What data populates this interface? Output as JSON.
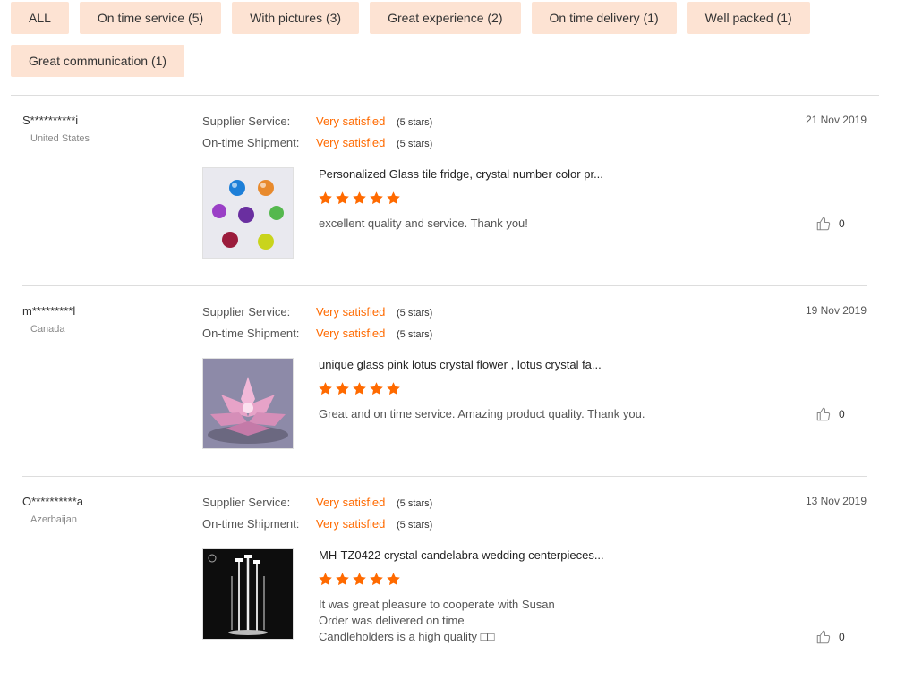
{
  "filters": [
    {
      "label": "ALL"
    },
    {
      "label": "On time service (5)"
    },
    {
      "label": "With pictures (3)"
    },
    {
      "label": "Great experience (2)"
    },
    {
      "label": "On time delivery (1)"
    },
    {
      "label": "Well packed (1)"
    },
    {
      "label": "Great communication (1)"
    }
  ],
  "colors": {
    "accent": "#ff6a00",
    "chip_bg": "#fde3d3",
    "separator": "#dddddd"
  },
  "reviews": [
    {
      "name": "S**********i",
      "country": "United States",
      "supplier_label": "Supplier Service:",
      "supplier_value": "Very satisfied",
      "supplier_stars": "(5 stars)",
      "shipment_label": "On-time Shipment:",
      "shipment_value": "Very satisfied",
      "shipment_stars": "(5 stars)",
      "date": "21 Nov 2019",
      "product_title": "Personalized Glass tile fridge, crystal number color pr...",
      "rating": 5,
      "comment_lines": [
        "excellent quality and service. Thank you!"
      ],
      "likes": "0"
    },
    {
      "name": "m*********l",
      "country": "Canada",
      "supplier_label": "Supplier Service:",
      "supplier_value": "Very satisfied",
      "supplier_stars": "(5 stars)",
      "shipment_label": "On-time Shipment:",
      "shipment_value": "Very satisfied",
      "shipment_stars": "(5 stars)",
      "date": "19 Nov 2019",
      "product_title": "unique glass pink lotus crystal flower , lotus crystal fa...",
      "rating": 5,
      "comment_lines": [
        "Great and on time service. Amazing product quality. Thank you."
      ],
      "likes": "0"
    },
    {
      "name": "O**********a",
      "country": "Azerbaijan",
      "supplier_label": "Supplier Service:",
      "supplier_value": "Very satisfied",
      "supplier_stars": "(5 stars)",
      "shipment_label": "On-time Shipment:",
      "shipment_value": "Very satisfied",
      "shipment_stars": "(5 stars)",
      "date": "13 Nov 2019",
      "product_title": "MH-TZ0422 crystal candelabra wedding centerpieces...",
      "rating": 5,
      "comment_lines": [
        "It was great pleasure to cooperate with Susan",
        "Order was delivered on time",
        "Candleholders is a high quality □□"
      ],
      "likes": "0"
    }
  ]
}
